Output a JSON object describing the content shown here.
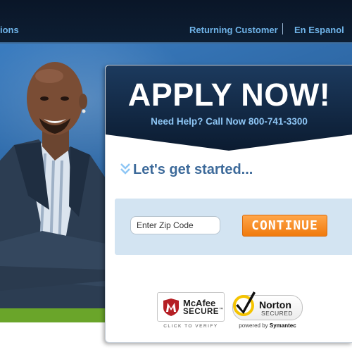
{
  "nav": {
    "left_link": "ions",
    "returning_customer": "Returning Customer",
    "en_espanol": "En Espanol"
  },
  "panel": {
    "title": "APPLY NOW!",
    "help_text": "Need Help? Call Now 800-741-3300",
    "lets_get_started": "Let's get started...",
    "zip_placeholder": "Enter Zip Code",
    "zip_value": "",
    "continue_label": "CONTINUE"
  },
  "badges": {
    "mcafee_name": "McAfee",
    "mcafee_secure": "SECURE",
    "mcafee_tm": "™",
    "mcafee_verify": "CLICK TO VERIFY",
    "norton_name": "Norton",
    "norton_secured": "SECURED",
    "norton_powered_prefix": "powered by",
    "norton_powered_brand": "Symantec"
  },
  "colors": {
    "nav_bg": "#0a1628",
    "nav_link": "#6fb3e8",
    "hero_blue": "#2f6aa8",
    "panel_header": "#0f2540",
    "accent_orange": "#f07a0d",
    "zip_box_bg": "#d3e4f2",
    "green_bar": "#6aa52a"
  },
  "icons": {
    "started_chevron": "double-chevron-down-icon",
    "mcafee_logo": "mcafee-shield-icon",
    "norton_logo": "norton-checkmark-icon"
  }
}
